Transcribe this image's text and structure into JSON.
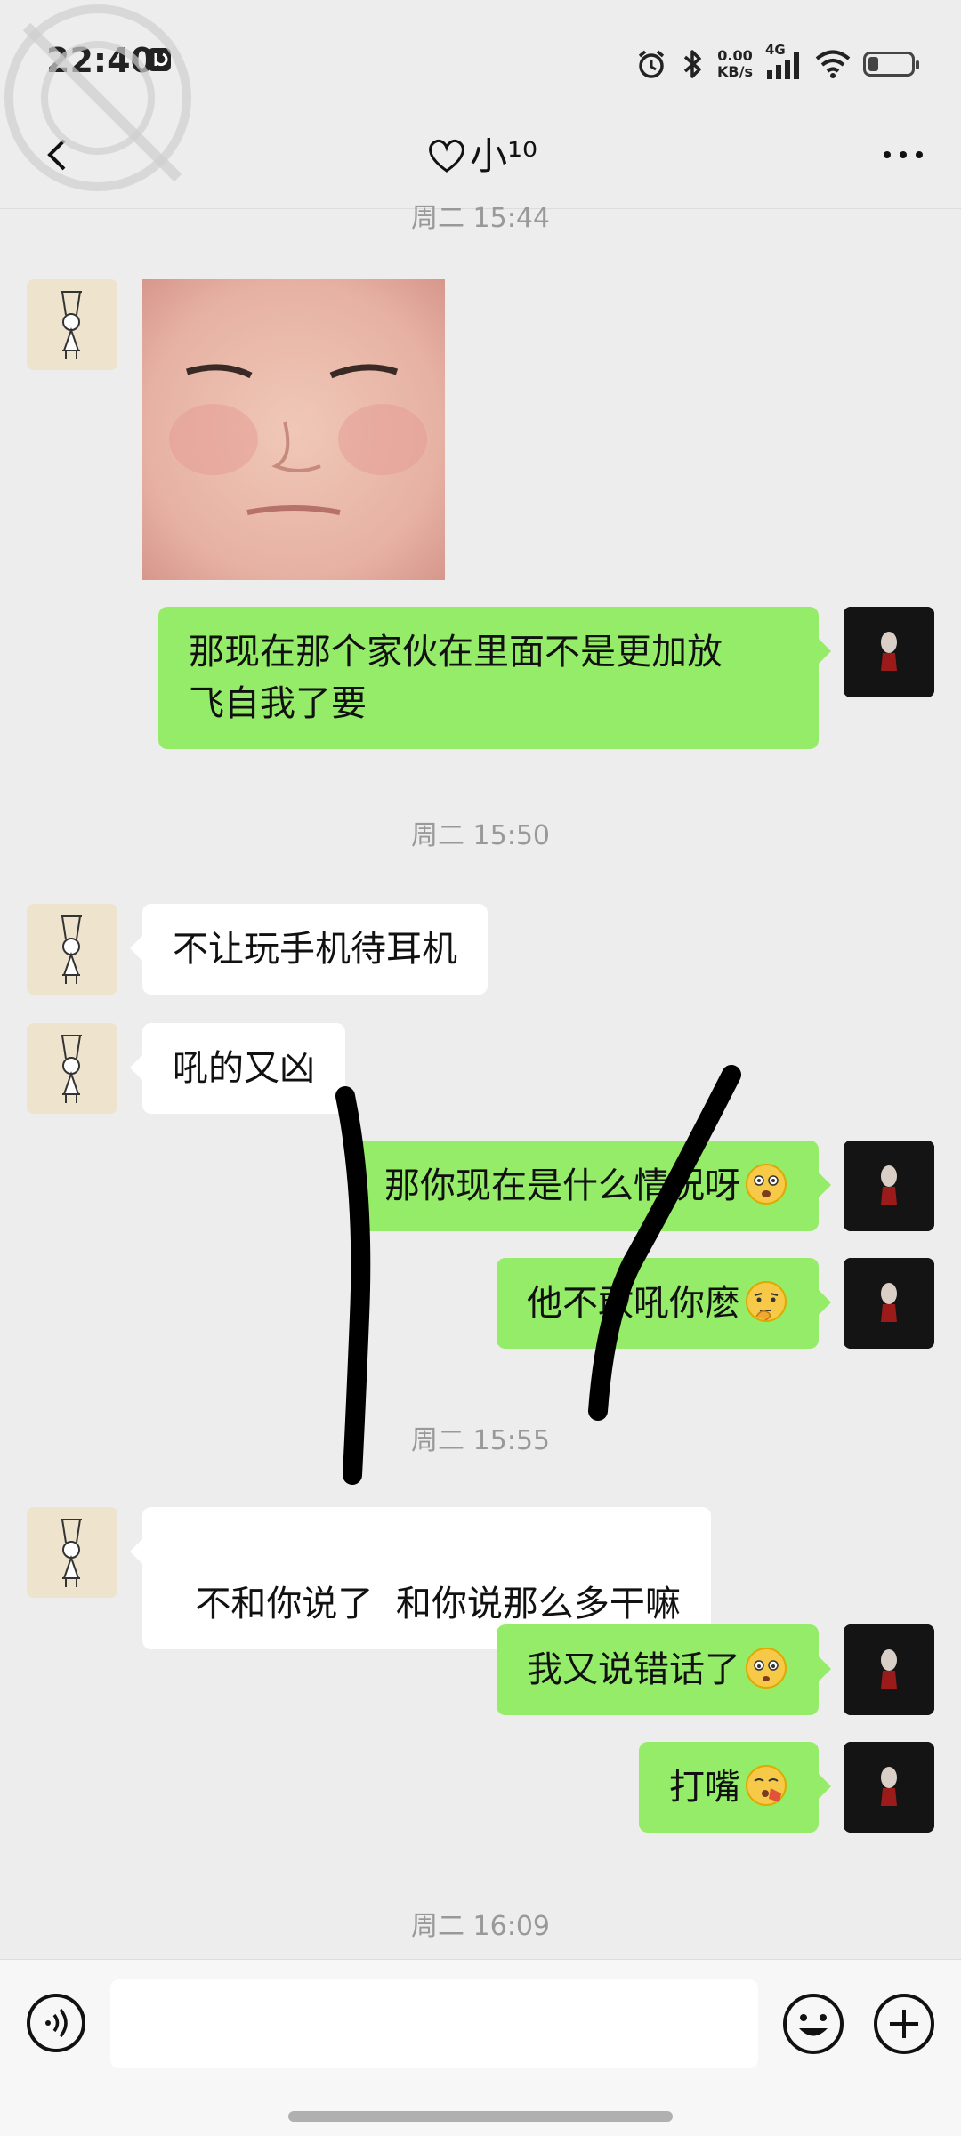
{
  "status_bar": {
    "time": "22:40",
    "net_speed_value": "0.00",
    "net_speed_unit": "KB/s",
    "network_type": "4G"
  },
  "header": {
    "title": "小¹⁰"
  },
  "messages": {
    "ts0": "周二 15:44",
    "m1_text": "那现在那个家伙在里面不是更加放",
    "m1_text2": "飞自我了要",
    "ts1": "周二 15:50",
    "m2_text": "不让玩手机待耳机",
    "m3_text": "吼的又凶",
    "m4_text": "那你现在是什么情况呀",
    "m5_text": "他不敢吼你麽",
    "ts2": "周二 15:55",
    "m6_text": "不和你说了  和你说那么多干嘛",
    "m7_text": "我又说错话了",
    "m8_text": "打嘴",
    "ts3": "周二 16:09"
  },
  "colors": {
    "background": "#ededed",
    "my_bubble": "#95ec69",
    "their_bubble": "#ffffff",
    "timestamp": "#999999"
  }
}
